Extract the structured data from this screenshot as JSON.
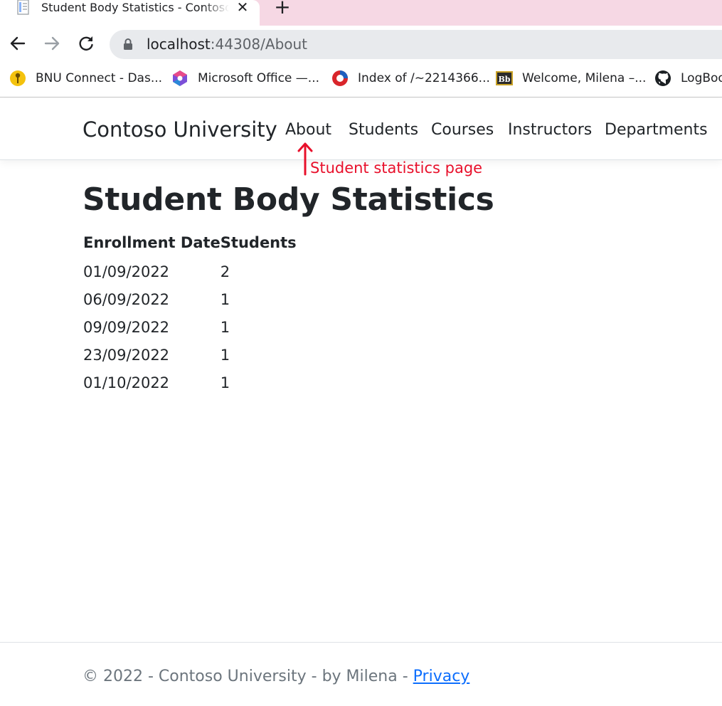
{
  "browser": {
    "tab_title": "Student Body Statistics - Contoso University",
    "close_glyph": "✕",
    "newtab_glyph": "+",
    "url_host": "localhost",
    "url_rest": ":44308/About",
    "bookmarks": [
      {
        "label": "BNU Connect - Das...",
        "icon": "key-icon"
      },
      {
        "label": "Microsoft Office —...",
        "icon": "office-icon"
      },
      {
        "label": "Index of /~2214366...",
        "icon": "index-icon"
      },
      {
        "label": "Welcome, Milena –...",
        "icon": "blackboard-icon"
      },
      {
        "label": "LogBoo",
        "icon": "github-icon"
      }
    ]
  },
  "site": {
    "brand": "Contoso University",
    "nav": [
      "About",
      "Students",
      "Courses",
      "Instructors",
      "Departments"
    ]
  },
  "annotation": {
    "text": "Student statistics page",
    "color": "#e8102b"
  },
  "main": {
    "title": "Student Body Statistics",
    "table": {
      "headers": [
        "Enrollment Date",
        "Students"
      ],
      "rows": [
        [
          "01/09/2022",
          "2"
        ],
        [
          "06/09/2022",
          "1"
        ],
        [
          "09/09/2022",
          "1"
        ],
        [
          "23/09/2022",
          "1"
        ],
        [
          "01/10/2022",
          "1"
        ]
      ]
    }
  },
  "footer": {
    "text": "© 2022 - Contoso University - by Milena - ",
    "privacy": "Privacy"
  },
  "colors": {
    "tabstrip": "#f6d8e4",
    "link": "#0d6efd",
    "muted": "#6c757d"
  }
}
